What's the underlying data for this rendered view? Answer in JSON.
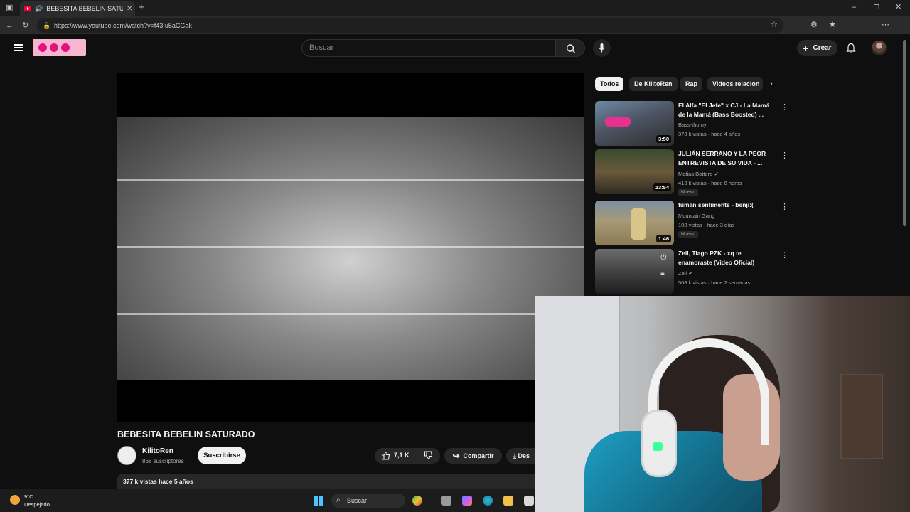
{
  "browser": {
    "tab_title": "BEBESITA BEBELIN SATURADO",
    "url": "https://www.youtube.com/watch?v=f43Iu5aCGak"
  },
  "header": {
    "search_placeholder": "Buscar",
    "create_label": "Crear"
  },
  "video": {
    "title": "BEBESITA BEBELIN SATURADO",
    "channel": "KilitoRen",
    "subscribers": "868 suscriptores",
    "subscribe_label": "Suscribirse",
    "likes": "7,1 K",
    "share_label": "Compartir",
    "download_label": "Des",
    "stats": "377 k vistas  hace 5 años"
  },
  "chips": [
    "Todos",
    "De KilitoRen",
    "Rap",
    "Videos relacion"
  ],
  "recommendations": [
    {
      "title": "El Alfa \"El Jefe\" x CJ - La Mamá de la Mamá (Bass Boosted) ...",
      "channel": "Bass-thomy",
      "meta": "378 k vistas · hace 4 años",
      "duration": "3:50",
      "new": ""
    },
    {
      "title": "JULIÁN SERRANO Y LA PEOR ENTREVISTA DE SU VIDA - ...",
      "channel": "Matias Bottero ✔",
      "meta": "413 k vistas · hace 8 horas",
      "duration": "13:54",
      "new": "Nuevo"
    },
    {
      "title": "fuman sentiments - benji:(",
      "channel": "Mountain Gang",
      "meta": "108 vistas · hace 3 días",
      "duration": "1:46",
      "new": "Nuevo"
    },
    {
      "title": "Zell, Tiago PZK - xq te enamoraste (Video Oficial)",
      "channel": "Zell ✔",
      "meta": "568 k vistas · hace 2 semanas",
      "duration": "",
      "new": ""
    }
  ],
  "taskbar": {
    "temp": "9°C",
    "condition": "Despejado",
    "search_label": "Buscar"
  },
  "icons": [
    "menu-icon",
    "search-icon",
    "mic-icon",
    "bell-icon",
    "plus-icon",
    "like-icon",
    "dislike-icon",
    "share-icon",
    "download-icon",
    "kebab-icon",
    "windows-icon"
  ]
}
